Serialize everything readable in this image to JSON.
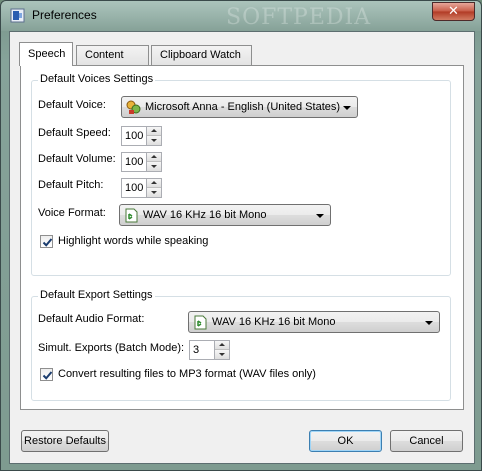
{
  "window": {
    "title": "Preferences",
    "close_glyph": "✕"
  },
  "tabs": [
    {
      "label": "Speech",
      "active": true
    },
    {
      "label": "Content",
      "active": false
    },
    {
      "label": "Clipboard Watch",
      "active": false
    }
  ],
  "voices": {
    "group_title": "Default Voices Settings",
    "voice_label": "Default Voice:",
    "voice_value": "Microsoft Anna - English (United States)",
    "speed_label": "Default Speed:",
    "speed_value": "100",
    "volume_label": "Default Volume:",
    "volume_value": "100",
    "pitch_label": "Default Pitch:",
    "pitch_value": "100",
    "format_label": "Voice Format:",
    "format_value": "WAV 16 KHz 16 bit Mono",
    "highlight_label": "Highlight words while speaking",
    "highlight_checked": true
  },
  "export": {
    "group_title": "Default Export Settings",
    "audio_format_label": "Default Audio Format:",
    "audio_format_value": "WAV 16 KHz 16 bit Mono",
    "simult_label": "Simult. Exports (Batch Mode):",
    "simult_value": "3",
    "convert_label": "Convert resulting files to MP3 format (WAV files only)",
    "convert_checked": true
  },
  "buttons": {
    "restore": "Restore Defaults",
    "ok": "OK",
    "cancel": "Cancel"
  },
  "watermark": "SOFTPEDIA",
  "colors": {
    "accent": "#3c7fb1",
    "close": "#c75a45"
  },
  "icons": {
    "app": "speaker-app-icon",
    "voice": "voice-agent-icon",
    "format": "audio-file-icon",
    "check": "checkmark-icon"
  }
}
